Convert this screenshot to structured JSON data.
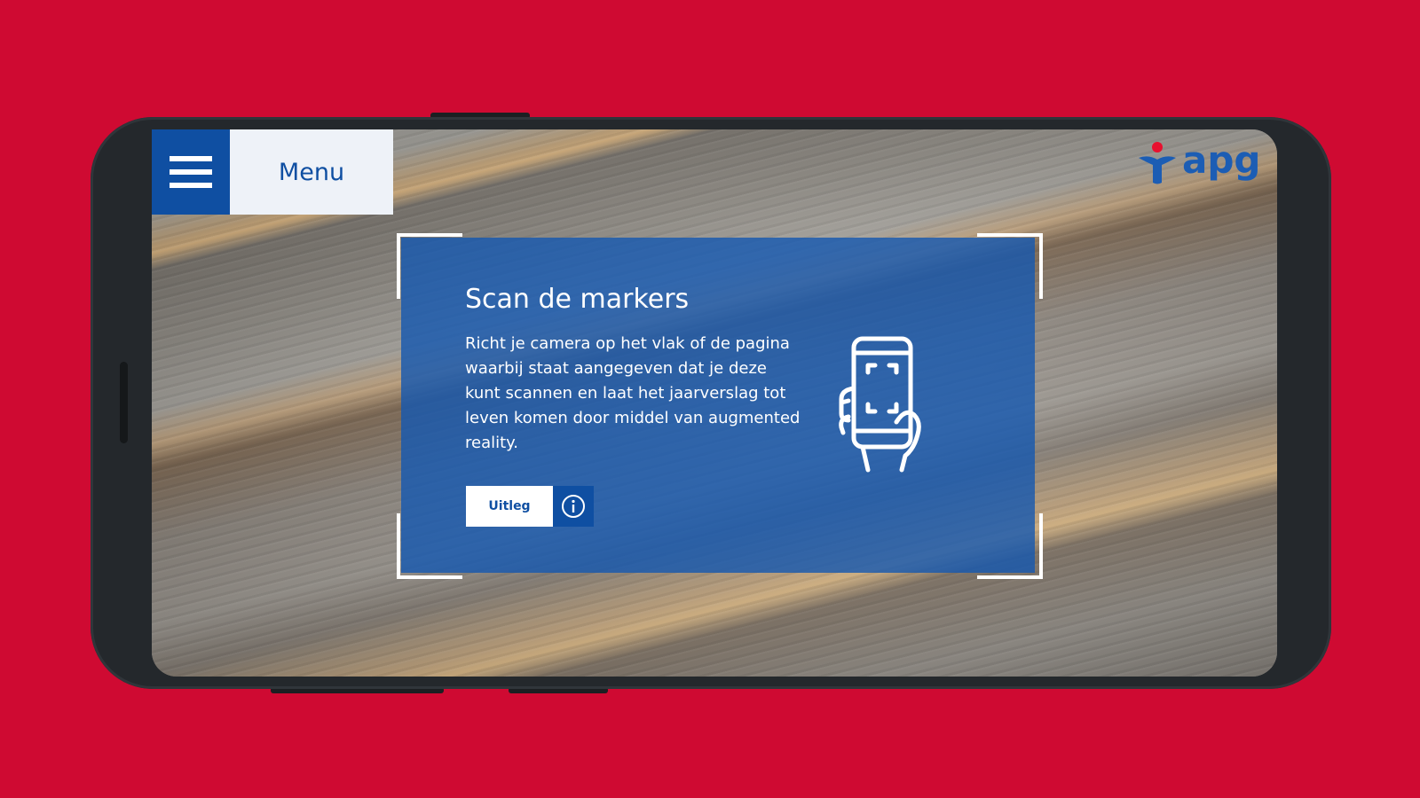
{
  "colors": {
    "background": "#cf0a32",
    "accent": "#0f4fa2",
    "panel": "#1458b0"
  },
  "menu": {
    "icon": "hamburger-icon",
    "label": "Menu"
  },
  "logo": {
    "text": "apg"
  },
  "scan_panel": {
    "title": "Scan de markers",
    "body": "Richt je camera op het vlak of de pagina waarbij staat aangegeven dat je deze kunt scannen en laat het jaarverslag tot leven komen door middel van augmented reality.",
    "explain_button_label": "Uitleg",
    "info_icon": "info-icon",
    "illustration_icon": "hand-phone-scan-icon"
  }
}
